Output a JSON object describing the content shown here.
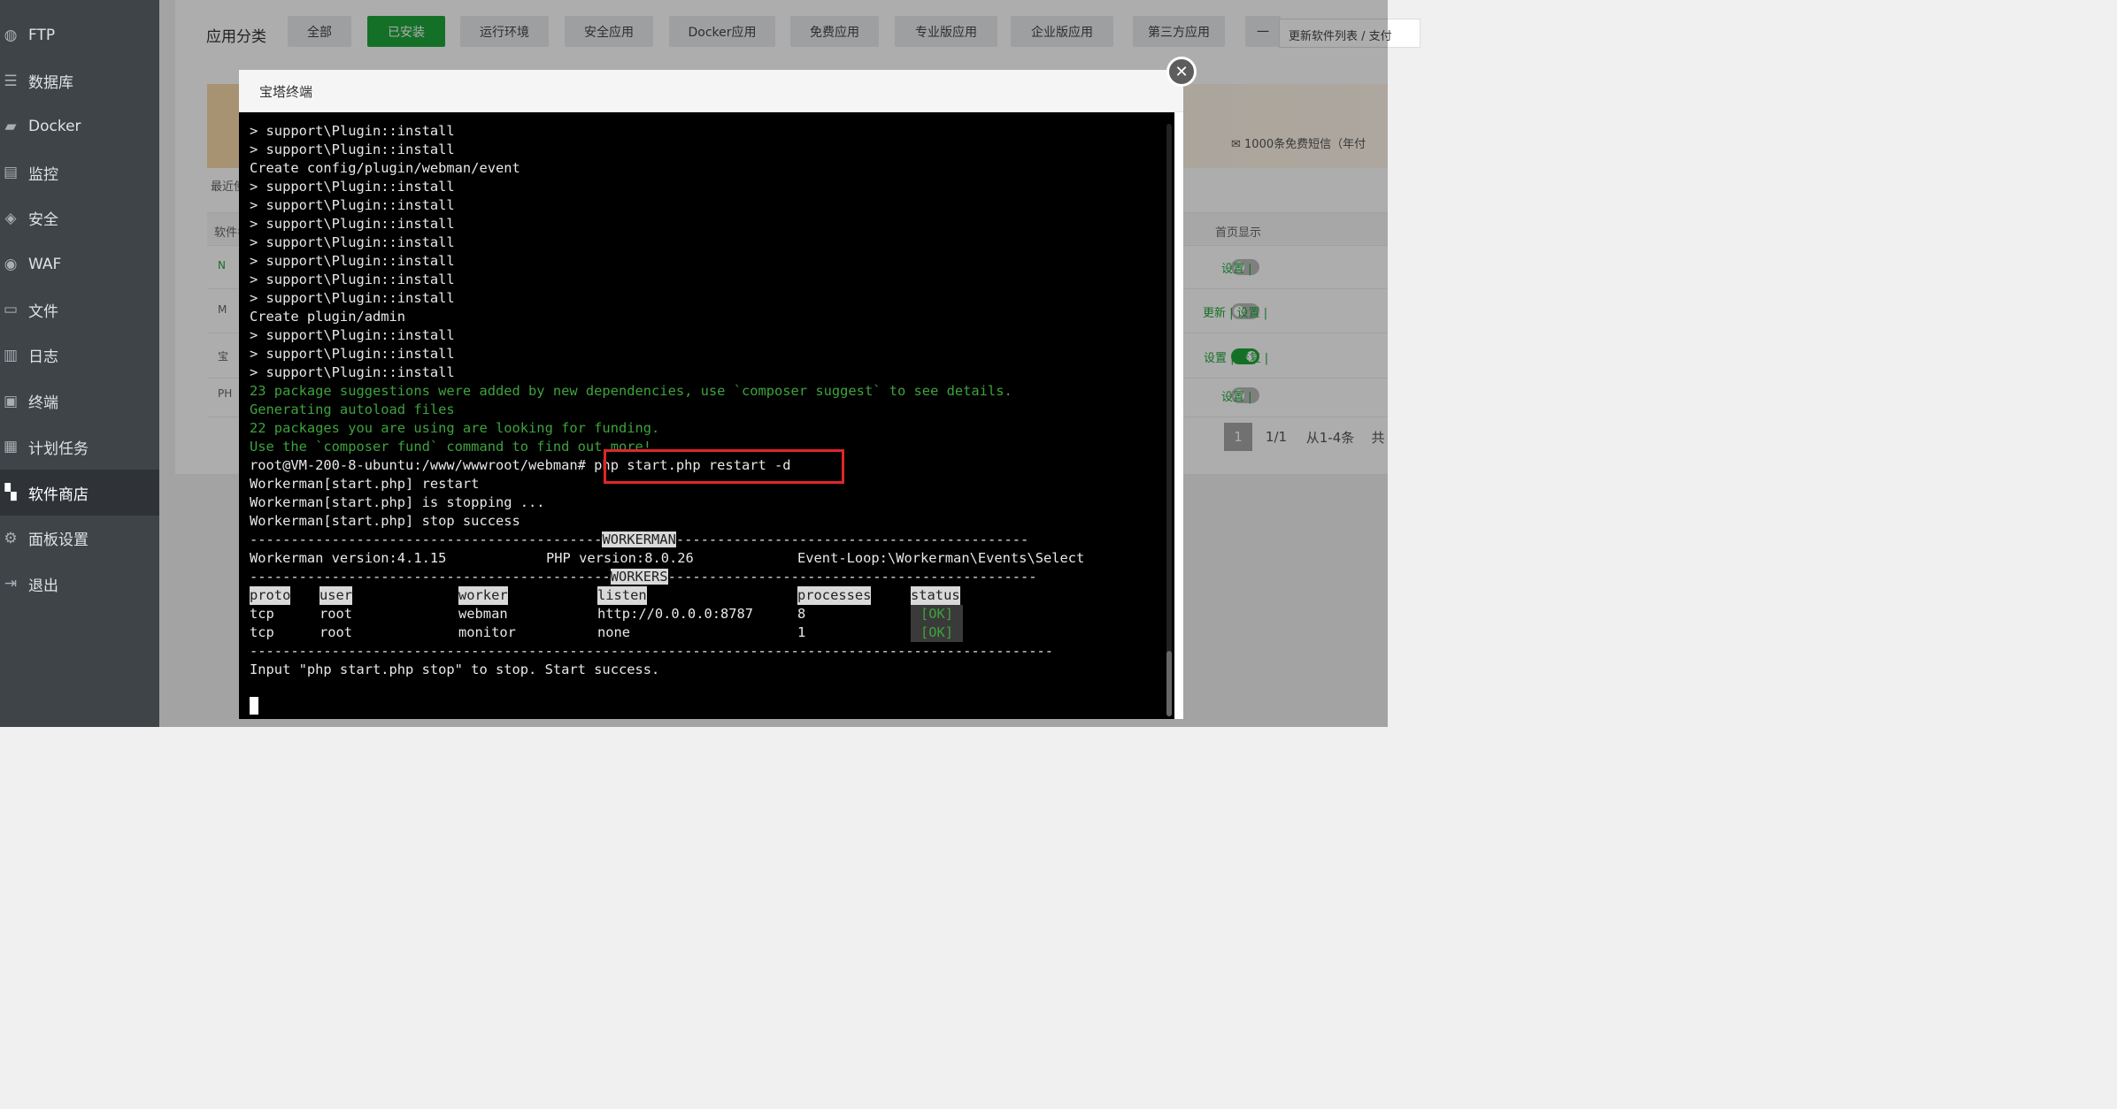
{
  "sidebar": {
    "items": [
      {
        "label": "FTP",
        "icon": "globe-icon",
        "active": false
      },
      {
        "label": "数据库",
        "icon": "database-icon",
        "active": false
      },
      {
        "label": "Docker",
        "icon": "docker-icon",
        "active": false
      },
      {
        "label": "监控",
        "icon": "chart-icon",
        "active": false
      },
      {
        "label": "安全",
        "icon": "shield-icon",
        "active": false
      },
      {
        "label": "WAF",
        "icon": "waf-icon",
        "active": false
      },
      {
        "label": "文件",
        "icon": "folder-icon",
        "active": false
      },
      {
        "label": "日志",
        "icon": "log-icon",
        "active": false
      },
      {
        "label": "终端",
        "icon": "terminal-icon",
        "active": false
      },
      {
        "label": "计划任务",
        "icon": "calendar-icon",
        "active": false
      },
      {
        "label": "软件商店",
        "icon": "grid-icon",
        "active": true
      },
      {
        "label": "面板设置",
        "icon": "gear-icon",
        "active": false
      },
      {
        "label": "退出",
        "icon": "logout-icon",
        "active": false
      }
    ]
  },
  "store": {
    "category_label": "应用分类",
    "categories": [
      "全部",
      "已安装",
      "运行环境",
      "安全应用",
      "Docker应用",
      "免费应用",
      "专业版应用",
      "企业版应用",
      "第三方应用",
      "一"
    ],
    "active_category": "已安装",
    "update_link": "更新软件列表 / 支付",
    "sms_promo": "1000条免费短信（年付",
    "recent_label": "最近使用",
    "table_head": {
      "name": "软件名称",
      "home": "首页显示"
    },
    "rows": [
      {
        "abbr": "N",
        "ops": "设置 |",
        "home_on": false
      },
      {
        "abbr": "M",
        "ops": "更新 | 设置 |",
        "home_on": false
      },
      {
        "abbr": "宝",
        "ops": "设置 | 修复 |",
        "home_on": true
      },
      {
        "abbr": "PH",
        "ops": "设置 |",
        "home_on": false
      }
    ],
    "pagination": {
      "current": "1",
      "total": "1/1",
      "range": "从1-4条",
      "count": "共"
    }
  },
  "modal": {
    "title": "宝塔终端",
    "close_label": "✕"
  },
  "terminal": {
    "lines": [
      {
        "text": "> support\\Plugin::install",
        "color": "white"
      },
      {
        "text": "> support\\Plugin::install",
        "color": "white"
      },
      {
        "text": "Create config/plugin/webman/event",
        "color": "white"
      },
      {
        "text": "> support\\Plugin::install",
        "color": "white"
      },
      {
        "text": "> support\\Plugin::install",
        "color": "white"
      },
      {
        "text": "> support\\Plugin::install",
        "color": "white"
      },
      {
        "text": "> support\\Plugin::install",
        "color": "white"
      },
      {
        "text": "> support\\Plugin::install",
        "color": "white"
      },
      {
        "text": "> support\\Plugin::install",
        "color": "white"
      },
      {
        "text": "> support\\Plugin::install",
        "color": "white"
      },
      {
        "text": "Create plugin/admin",
        "color": "white"
      },
      {
        "text": "> support\\Plugin::install",
        "color": "white"
      },
      {
        "text": "> support\\Plugin::install",
        "color": "white"
      },
      {
        "text": "> support\\Plugin::install",
        "color": "white"
      },
      {
        "text": "23 package suggestions were added by new dependencies, use `composer suggest` to see details.",
        "color": "green"
      },
      {
        "text": "Generating autoload files",
        "color": "green"
      },
      {
        "text": "22 packages you are using are looking for funding.",
        "color": "green"
      },
      {
        "text": "Use the `composer fund` command to find out more!",
        "color": "green"
      },
      {
        "text": "root@VM-200-8-ubuntu:/www/wwwroot/webman# php start.php restart -d",
        "color": "white"
      },
      {
        "text": "Workerman[start.php] restart",
        "color": "white"
      },
      {
        "text": "Workerman[start.php] is stopping ...",
        "color": "white"
      },
      {
        "text": "Workerman[start.php] stop success",
        "color": "white"
      }
    ],
    "workerman_banner": "WORKERMAN",
    "version_line": {
      "workerman": "Workerman version:4.1.15",
      "php": "PHP version:8.0.26",
      "loop": "Event-Loop:\\Workerman\\Events\\Select"
    },
    "workers_banner": "WORKERS",
    "worker_columns": [
      "proto",
      "user",
      "worker",
      "listen",
      "processes",
      "status"
    ],
    "workers": [
      {
        "proto": "tcp",
        "user": "root",
        "worker": "webman",
        "listen": "http://0.0.0.0:8787",
        "processes": "8",
        "status": "[OK]"
      },
      {
        "proto": "tcp",
        "user": "root",
        "worker": "monitor",
        "listen": "none",
        "processes": "1",
        "status": "[OK]"
      }
    ],
    "footer_line": "Input \"php start.php stop\" to stop. Start success."
  }
}
